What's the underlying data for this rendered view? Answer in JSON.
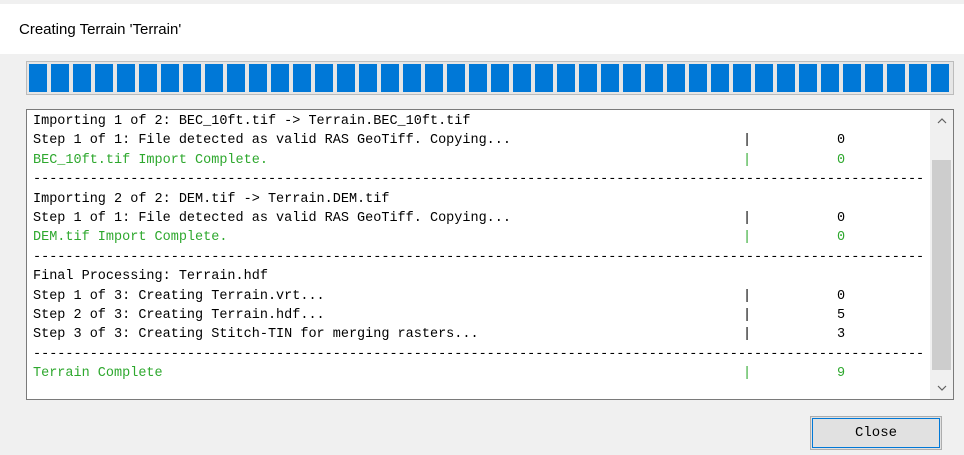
{
  "window": {
    "title": "Creating Terrain 'Terrain'"
  },
  "progress": {
    "value": 1.0,
    "color": "#0078d7"
  },
  "log": {
    "separator": "------------------------------------------------------------------------------------------------------------------------",
    "importing_1": "Importing 1 of 2: BEC_10ft.tif -> Terrain.BEC_10ft.tif",
    "importing_1_step1": {
      "text": "Step 1 of 1: File detected as valid RAS GeoTiff. Copying...",
      "bar": "|",
      "value": "0"
    },
    "importing_1_complete": {
      "text": "BEC_10ft.tif Import Complete.",
      "bar": "|",
      "value": "0"
    },
    "importing_2": "Importing 2 of 2: DEM.tif -> Terrain.DEM.tif",
    "importing_2_step1": {
      "text": "Step 1 of 1: File detected as valid RAS GeoTiff. Copying...",
      "bar": "|",
      "value": "0"
    },
    "importing_2_complete": {
      "text": "DEM.tif Import Complete.",
      "bar": "|",
      "value": "0"
    },
    "final": "Final Processing: Terrain.hdf",
    "final_step1": {
      "text": "Step 1 of 3: Creating Terrain.vrt...",
      "bar": "|",
      "value": "0"
    },
    "final_step2": {
      "text": "Step 2 of 3: Creating Terrain.hdf...",
      "bar": "|",
      "value": "5"
    },
    "final_step3": {
      "text": "Step 3 of 3: Creating Stitch-TIN for merging rasters...",
      "bar": "|",
      "value": "3"
    },
    "terrain_complete": {
      "text": "Terrain Complete",
      "bar": "|",
      "value": "9"
    },
    "success_color": "#2ea82e"
  },
  "scrollbar": {
    "up_icon": "chevron-up-icon",
    "down_icon": "chevron-down-icon"
  },
  "buttons": {
    "close_label": "Close"
  }
}
